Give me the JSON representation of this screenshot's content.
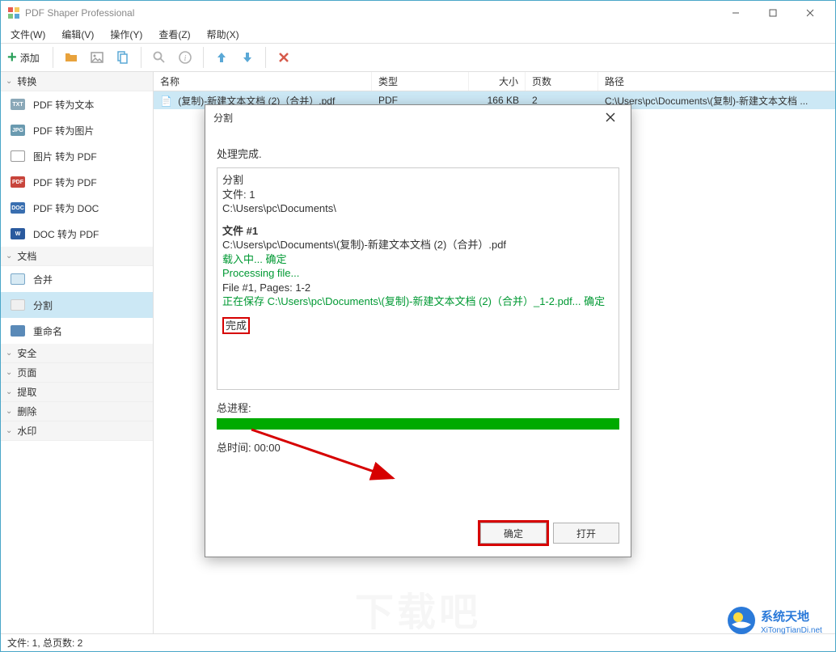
{
  "window": {
    "title": "PDF Shaper Professional"
  },
  "menubar": {
    "items": [
      {
        "label": "文件(W)"
      },
      {
        "label": "编辑(V)"
      },
      {
        "label": "操作(Y)"
      },
      {
        "label": "查看(Z)"
      },
      {
        "label": "帮助(X)"
      }
    ]
  },
  "toolbar": {
    "add_label": "添加"
  },
  "sidebar": {
    "groups": [
      {
        "header": "转换",
        "items": [
          {
            "label": "PDF 转为文本",
            "icon": "txt"
          },
          {
            "label": "PDF 转为图片",
            "icon": "jpg"
          },
          {
            "label": "图片 转为 PDF",
            "icon": "img"
          },
          {
            "label": "PDF 转为 PDF",
            "icon": "pdf"
          },
          {
            "label": "PDF 转为 DOC",
            "icon": "doc"
          },
          {
            "label": "DOC 转为 PDF",
            "icon": "docw"
          }
        ]
      },
      {
        "header": "文档",
        "items": [
          {
            "label": "合并",
            "icon": "merge"
          },
          {
            "label": "分割",
            "icon": "split",
            "selected": true
          },
          {
            "label": "重命名",
            "icon": "rename"
          }
        ]
      },
      {
        "header": "安全",
        "items": []
      },
      {
        "header": "页面",
        "items": []
      },
      {
        "header": "提取",
        "items": []
      },
      {
        "header": "删除",
        "items": []
      },
      {
        "header": "水印",
        "items": []
      }
    ]
  },
  "list": {
    "columns": {
      "name": "名称",
      "type": "类型",
      "size": "大小",
      "pages": "页数",
      "path": "路径"
    },
    "rows": [
      {
        "name": "(复制)-新建文本文档 (2)（合并）.pdf",
        "type": "PDF",
        "size": "166 KB",
        "pages": "2",
        "path": "C:\\Users\\pc\\Documents\\(复制)-新建文本文档 ..."
      }
    ]
  },
  "modal": {
    "title": "分割",
    "status": "处理完成.",
    "log": {
      "l1": "分割",
      "l2": "文件: 1",
      "l3": "C:\\Users\\pc\\Documents\\",
      "l4": "文件 #1",
      "l5": "C:\\Users\\pc\\Documents\\(复制)-新建文本文档 (2)（合并）.pdf",
      "l6": "载入中... 确定",
      "l7": "Processing file...",
      "l8": "File #1, Pages: 1-2",
      "l9": "正在保存 C:\\Users\\pc\\Documents\\(复制)-新建文本文档 (2)（合并）_1-2.pdf... 确定",
      "l10": "完成"
    },
    "progress_label": "总进程:",
    "total_time_label": "总时间: 00:00",
    "ok_label": "确定",
    "open_label": "打开"
  },
  "statusbar": {
    "text": "文件: 1, 总页数: 2"
  },
  "watermark": {
    "brand_top": "系统天地",
    "brand_bottom": "XiTongTianDi.net",
    "faint": "下载吧"
  }
}
